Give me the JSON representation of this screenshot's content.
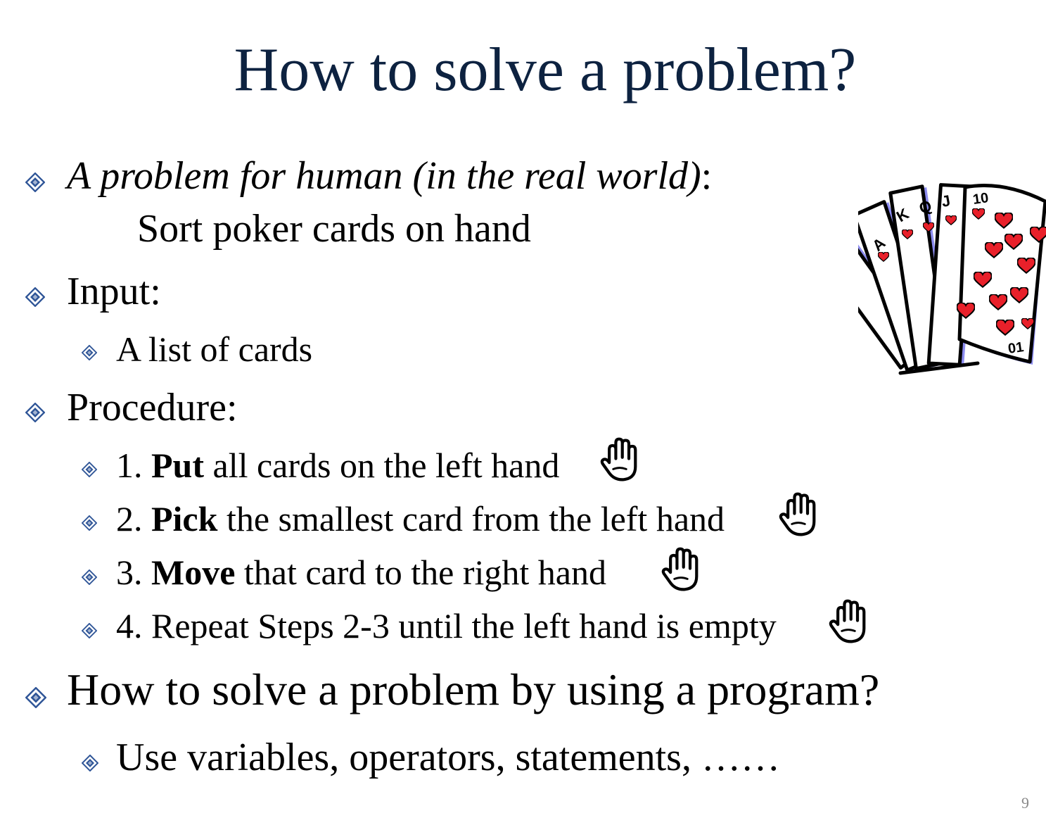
{
  "title": "How to solve a problem?",
  "bullets": {
    "b1": {
      "prefix": "A problem for human (in the real world)",
      "suffix": ":",
      "continuation": "Sort poker cards on hand"
    },
    "b2": {
      "text": "Input:",
      "sub": "A list of cards"
    },
    "b3": {
      "text": "Procedure:",
      "steps": [
        {
          "num": "1. ",
          "verb": "Put",
          "rest": " all cards on the left hand"
        },
        {
          "num": "2. ",
          "verb": "Pick",
          "rest": " the smallest card from the left hand"
        },
        {
          "num": "3. ",
          "verb": "Move",
          "rest": " that card to the right hand"
        },
        {
          "text": "4. Repeat Steps 2-3 until the left hand is empty"
        }
      ]
    },
    "b4": {
      "text": "How to solve a problem by using a program?",
      "sub": "Use variables, operators, statements, ……"
    }
  },
  "card_labels": [
    "A",
    "K",
    "Q",
    "J",
    "10",
    "01"
  ],
  "page_number": "9",
  "colors": {
    "title": "#0d2240",
    "bullet": "#2f5597",
    "heart": "#e8202a",
    "card_shadow": "#8c8cf0"
  },
  "icons": {
    "bullet": "diamond-bullet-icon",
    "hand": "raised-hand-icon",
    "clipart": "poker-cards-clipart"
  }
}
